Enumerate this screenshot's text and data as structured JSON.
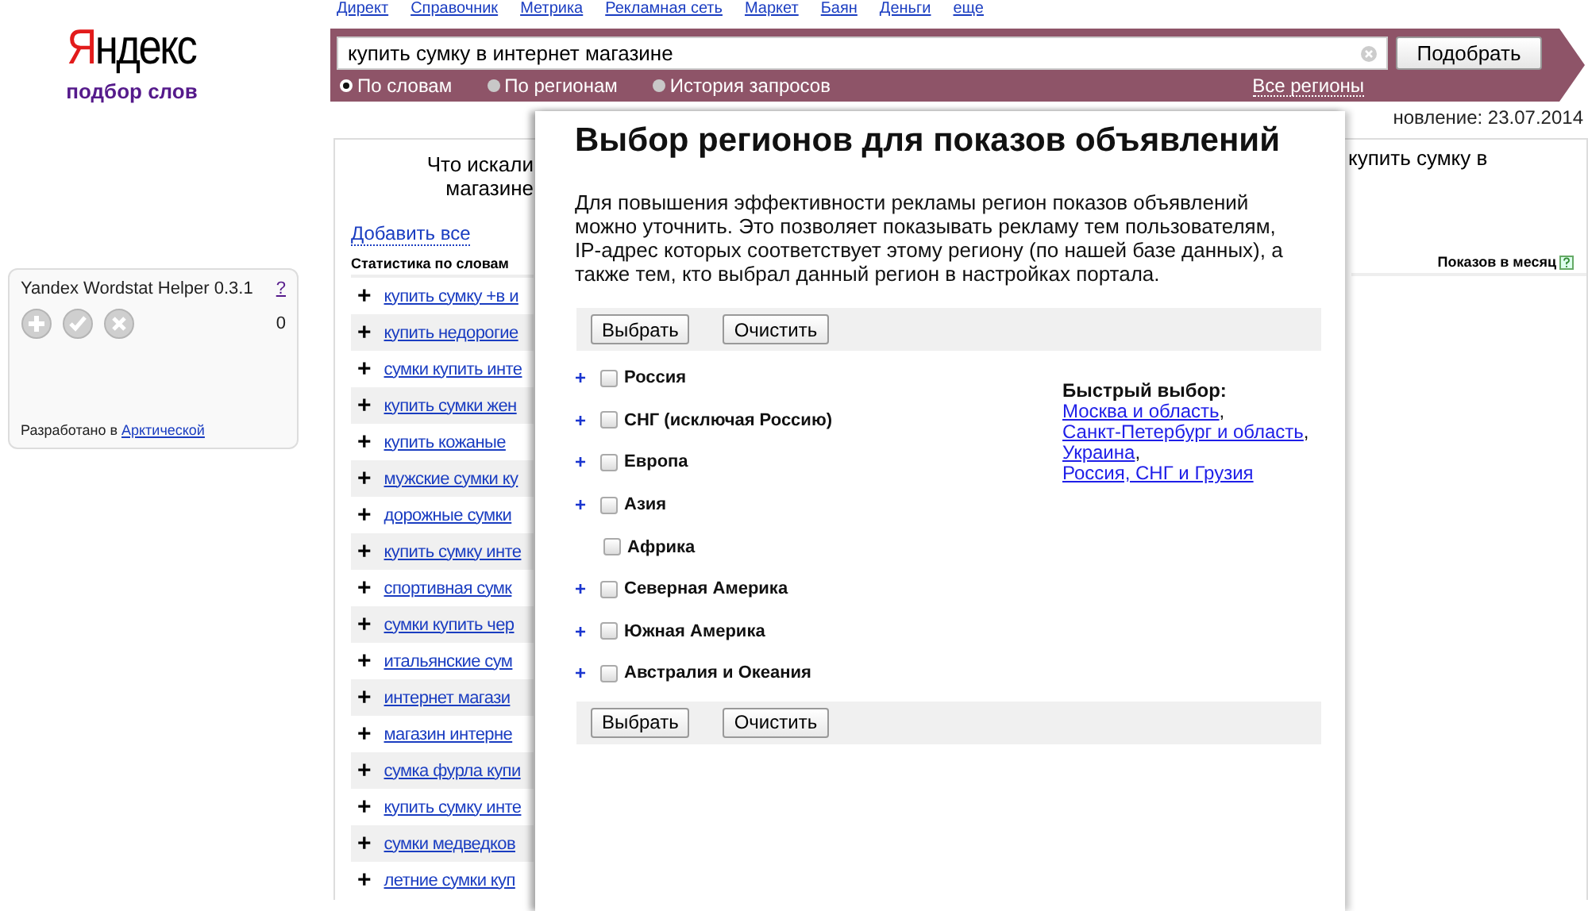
{
  "top_nav": [
    "Директ",
    "Справочник",
    "Метрика",
    "Рекламная сеть",
    "Маркет",
    "Баян",
    "Деньги",
    "еще"
  ],
  "logo": "Яндекс",
  "logo_subtitle": "подбор слов",
  "search": {
    "value": "купить сумку в интернет магазине",
    "button": "Подобрать",
    "modes": [
      {
        "label": "По словам",
        "selected": true
      },
      {
        "label": "По регионам",
        "selected": false
      },
      {
        "label": "История запросов",
        "selected": false
      }
    ],
    "region_link": "Все регионы"
  },
  "helper": {
    "title": "Yandex Wordstat Helper 0.3.1",
    "help": "?",
    "count": "0",
    "credit_text": "Разработано в",
    "credit_link": "Арктической"
  },
  "results": {
    "updated": "новление: 23.07.2014",
    "left_title": [
      "Что искали",
      "магазине"
    ],
    "right_title": "купить сумку в",
    "add_all": "Добавить все",
    "left_header": "Статистика по словам",
    "right_header": "Показов в месяц",
    "rows": [
      {
        "icon": "+",
        "text": "купить сумку +в и"
      },
      {
        "icon": "+",
        "text": "купить недорогие"
      },
      {
        "icon": "+",
        "text": "сумки купить инте"
      },
      {
        "icon": "+",
        "text": "купить сумки жен"
      },
      {
        "icon": "+",
        "text": "купить кожаные"
      },
      {
        "icon": "+",
        "text": "мужские сумки ку"
      },
      {
        "icon": "+",
        "text": "дорожные сумки"
      },
      {
        "icon": "+",
        "text": "купить сумку инте"
      },
      {
        "icon": "+",
        "text": "спортивная сумк"
      },
      {
        "icon": "+",
        "text": "сумки купить чер"
      },
      {
        "icon": "+",
        "text": "итальянские сум"
      },
      {
        "icon": "+",
        "text": "интернет магази"
      },
      {
        "icon": "+",
        "text": "магазин интерне"
      },
      {
        "icon": "+",
        "text": "сумка фурла купи"
      },
      {
        "icon": "+",
        "text": "купить сумку инте"
      },
      {
        "icon": "+",
        "text": "сумки медведков"
      },
      {
        "icon": "+",
        "text": "летние сумки куп"
      }
    ]
  },
  "modal": {
    "title": "Выбор регионов для показов объявлений",
    "text": "Для повышения эффективности рекламы регион показов объявлений можно уточнить. Это позволяет показывать рекламу тем пользователям, IP-адрес которых соответствует этому региону (по нашей базе данных), а также тем, кто выбрал данный регион в настройках портала.",
    "buttons": [
      "Выбрать",
      "Очистить"
    ],
    "regions": [
      {
        "name": "Россия",
        "expander": "+",
        "checked": false
      },
      {
        "name": "СНГ (исключая Россию)",
        "expander": "+",
        "checked": false
      },
      {
        "name": "Европа",
        "expander": "+",
        "checked": false
      },
      {
        "name": "Азия",
        "expander": "+",
        "checked": false
      },
      {
        "name": "Африка",
        "checked": false
      },
      {
        "name": "Северная Америка",
        "expander": "+",
        "checked": false
      },
      {
        "name": "Южная Америка",
        "expander": "+",
        "checked": false
      },
      {
        "name": "Австралия и Океания",
        "expander": "+",
        "checked": false
      }
    ],
    "quick_title": "Быстрый выбор:",
    "quick_links": [
      {
        "text": "Москва и область",
        "separator": ","
      },
      {
        "text": "Санкт-Петербург и область",
        "separator": ","
      },
      {
        "text": "Украина",
        "separator": ","
      },
      {
        "text": "Россия, СНГ и Грузия"
      }
    ],
    "bottom_buttons": [
      "Выбрать",
      "Очистить"
    ]
  }
}
